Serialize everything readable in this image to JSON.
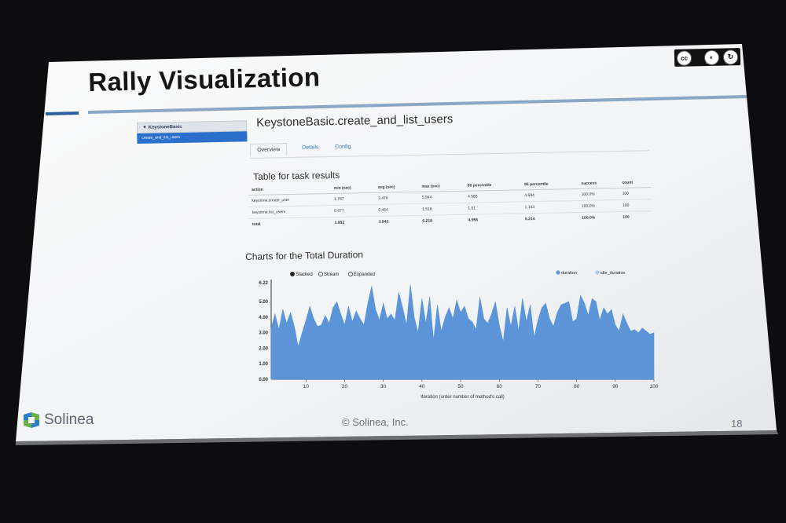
{
  "slide": {
    "title": "Rally Visualization",
    "footer_brand": "Solinea",
    "copyright": "© Solinea, Inc.",
    "page_number": "18",
    "license": {
      "badge": "cc",
      "labels": [
        "BY",
        "SA"
      ]
    }
  },
  "app": {
    "sidebar": {
      "group": "▼ KeystoneBasic",
      "selected_item": "create_and_list_users"
    },
    "page_title": "KeystoneBasic.create_and_list_users",
    "tabs": [
      "Overview",
      "Details",
      "Config"
    ],
    "table_heading": "Table for task results",
    "table": {
      "columns": [
        "action",
        "min (sec)",
        "avg (sec)",
        "max (sec)",
        "90 percentile",
        "95 percentile",
        "success",
        "count"
      ],
      "rows": [
        [
          "keystone.create_user",
          "1.767",
          "3.478",
          "5.944",
          "4.565",
          "4.694",
          "100.0%",
          "100"
        ],
        [
          "keystone.list_users",
          "0.077",
          "0.464",
          "1.516",
          "1.01",
          "1.143",
          "100.0%",
          "100"
        ],
        [
          "total",
          "1.882",
          "3.942",
          "6.218",
          "4.956",
          "5.214",
          "100.0%",
          "100"
        ]
      ]
    },
    "chart_heading": "Charts for the Total Duration",
    "chart_controls": [
      "Stacked",
      "Stream",
      "Expanded"
    ],
    "chart_selected_mode": "Stacked",
    "legend": [
      "duration",
      "idle_duration"
    ]
  },
  "chart_data": {
    "type": "area",
    "xlabel": "Iteration (order number of method's call)",
    "ylabel": "",
    "ylim": [
      0,
      6.22
    ],
    "xlim": [
      1,
      100
    ],
    "y_ticks": [
      "0.00",
      "1.00",
      "2.00",
      "3.00",
      "4.00",
      "5.00",
      "6.22"
    ],
    "x_ticks": [
      "10",
      "20",
      "30",
      "40",
      "50",
      "60",
      "70",
      "80",
      "90",
      "100"
    ],
    "series": [
      {
        "name": "duration",
        "color": "#5b95d8",
        "values": [
          3.3,
          4.2,
          3.2,
          4.5,
          3.6,
          4.3,
          3.4,
          2.1,
          3.0,
          3.8,
          4.7,
          3.9,
          3.4,
          3.5,
          4.1,
          3.6,
          4.6,
          5.0,
          4.2,
          3.5,
          4.7,
          3.7,
          4.4,
          3.9,
          3.5,
          4.9,
          6.0,
          4.5,
          3.8,
          4.9,
          3.9,
          4.2,
          3.8,
          5.6,
          4.6,
          3.5,
          6.1,
          4.0,
          3.0,
          5.2,
          3.6,
          5.3,
          2.5,
          4.8,
          3.1,
          4.0,
          4.6,
          3.9,
          5.1,
          4.3,
          4.7,
          3.9,
          3.7,
          3.2,
          5.3,
          3.9,
          3.6,
          4.2,
          5.0,
          3.5,
          2.4,
          4.6,
          3.4,
          4.7,
          3.1,
          5.2,
          3.7,
          4.8,
          2.7,
          3.8,
          4.6,
          4.9,
          3.9,
          3.4,
          4.3,
          4.8,
          4.9,
          5.0,
          3.7,
          3.9,
          5.4,
          4.9,
          4.1,
          5.2,
          5.0,
          3.8,
          4.6,
          4.2,
          4.5,
          3.5,
          3.1,
          4.2,
          3.6,
          3.1,
          3.2,
          3.0,
          3.3,
          3.1,
          2.9,
          3.0
        ]
      },
      {
        "name": "idle_duration",
        "color": "#a9c8ee",
        "values": []
      }
    ],
    "legend_position": "top-right",
    "grid": false
  }
}
